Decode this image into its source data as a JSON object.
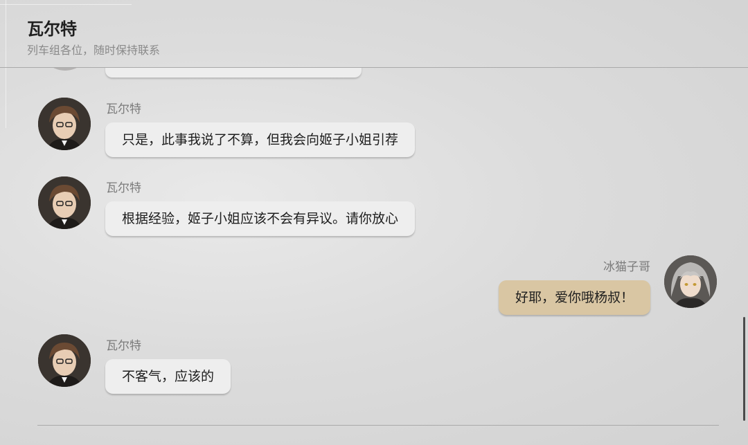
{
  "header": {
    "title": "瓦尔特",
    "subtitle": "列车组各位，随时保持联系"
  },
  "messages": [
    {
      "sender": "瓦尔特",
      "text": "只是，此事我说了不算，但我会向姬子小姐引荐",
      "side": "left",
      "avatar": "welt-avatar"
    },
    {
      "sender": "瓦尔特",
      "text": "根据经验，姬子小姐应该不会有异议。请你放心",
      "side": "left",
      "avatar": "welt-avatar"
    },
    {
      "sender": "冰猫子哥",
      "text": "好耶，爱你哦杨叔！",
      "side": "right",
      "avatar": "player-avatar"
    },
    {
      "sender": "瓦尔特",
      "text": "不客气，应该的",
      "side": "left",
      "avatar": "welt-avatar"
    }
  ],
  "colors": {
    "bubble_other": "#eeeeee",
    "bubble_mine": "#d9c6a3",
    "divider": "#a9a9a9"
  }
}
